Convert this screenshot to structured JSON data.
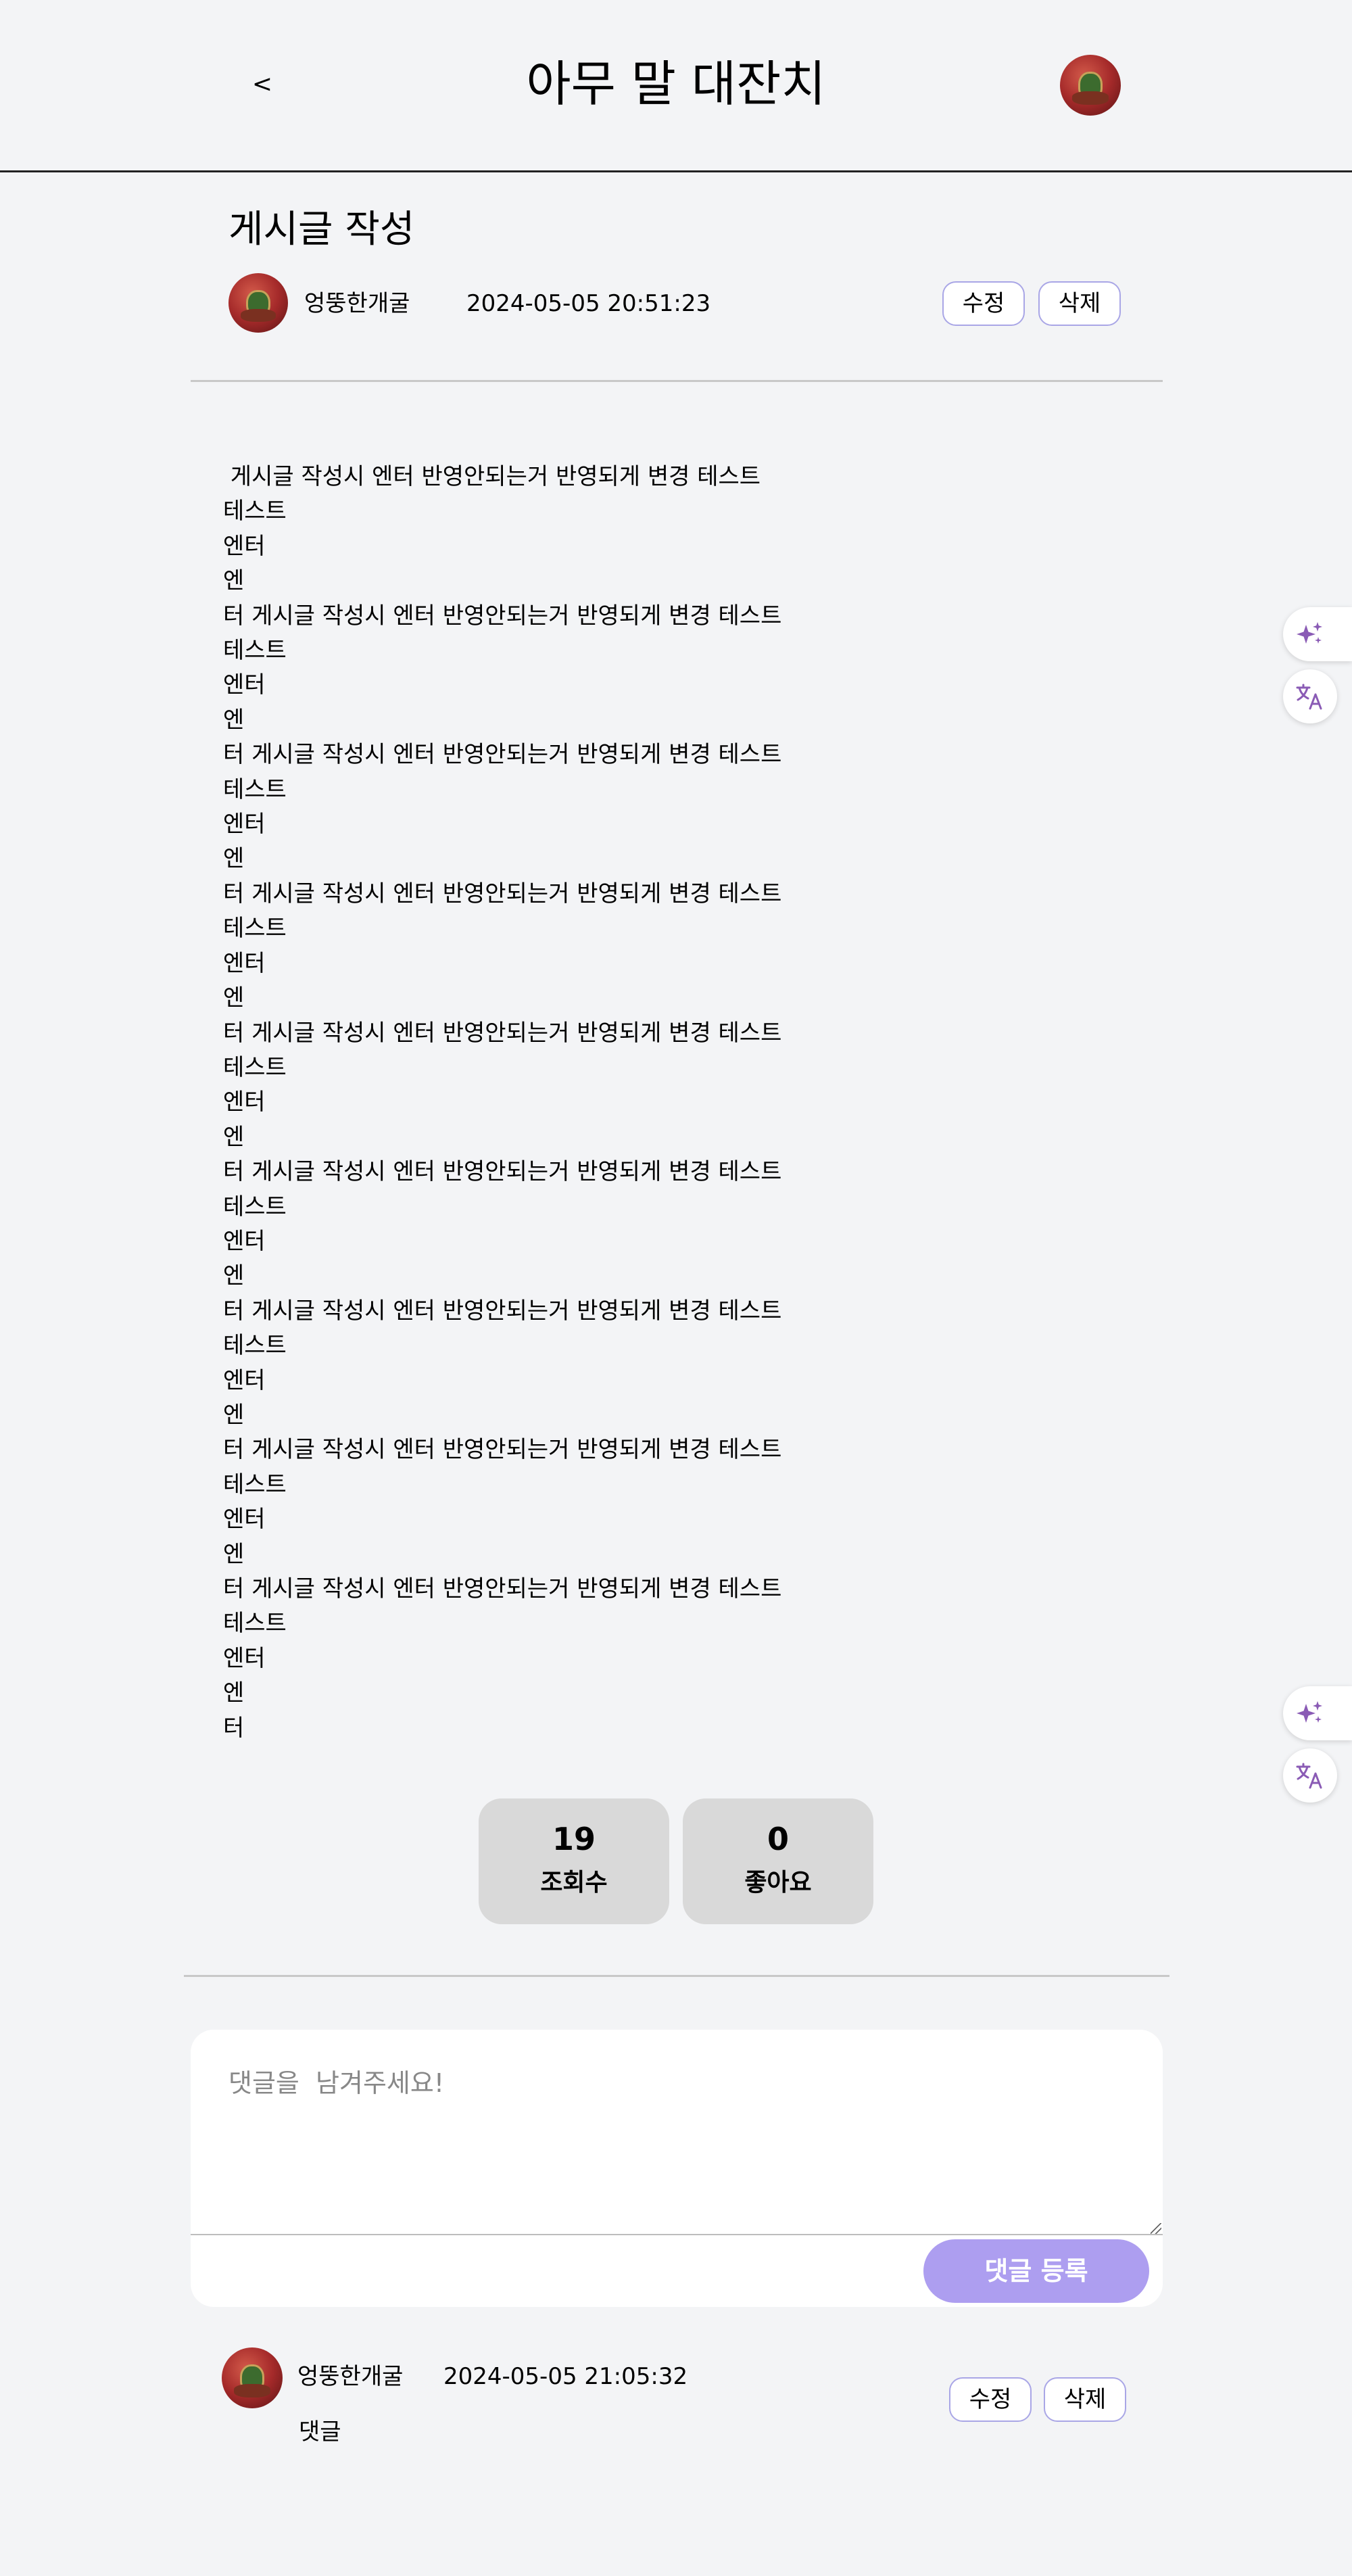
{
  "header": {
    "back_label": "<",
    "title": "아무 말 대잔치",
    "profile_avatar_icon": "user-avatar"
  },
  "post": {
    "title": "게시글 작성",
    "author": "엉뚱한개굴",
    "date": "2024-05-05 20:51:23",
    "edit_label": "수정",
    "delete_label": "삭제",
    "body": " 게시글 작성시 엔터 반영안되는거 반영되게 변경 테스트\n테스트\n엔터\n엔\n터 게시글 작성시 엔터 반영안되는거 반영되게 변경 테스트\n테스트\n엔터\n엔\n터 게시글 작성시 엔터 반영안되는거 반영되게 변경 테스트\n테스트\n엔터\n엔\n터 게시글 작성시 엔터 반영안되는거 반영되게 변경 테스트\n테스트\n엔터\n엔\n터 게시글 작성시 엔터 반영안되는거 반영되게 변경 테스트\n테스트\n엔터\n엔\n터 게시글 작성시 엔터 반영안되는거 반영되게 변경 테스트\n테스트\n엔터\n엔\n터 게시글 작성시 엔터 반영안되는거 반영되게 변경 테스트\n테스트\n엔터\n엔\n터 게시글 작성시 엔터 반영안되는거 반영되게 변경 테스트\n테스트\n엔터\n엔\n터 게시글 작성시 엔터 반영안되는거 반영되게 변경 테스트\n테스트\n엔터\n엔\n터"
  },
  "stats": {
    "views_value": "19",
    "views_label": "조회수",
    "likes_value": "0",
    "likes_label": "좋아요"
  },
  "comment_form": {
    "placeholder": "댓글을  남겨주세요!",
    "submit_label": "댓글 등록"
  },
  "comments": [
    {
      "author": "엉뚱한개굴",
      "date": "2024-05-05 21:05:32",
      "text": "댓글",
      "edit_label": "수정",
      "delete_label": "삭제"
    }
  ],
  "floating_tools": {
    "ai_icon": "sparkle-icon",
    "translate_icon": "translate-icon"
  },
  "colors": {
    "background": "#f3f4f6",
    "accent": "#ad9ef0",
    "button_border": "#a9a6e6",
    "stat_box": "#d9d9d9",
    "icon_purple": "#8a5bb5"
  }
}
